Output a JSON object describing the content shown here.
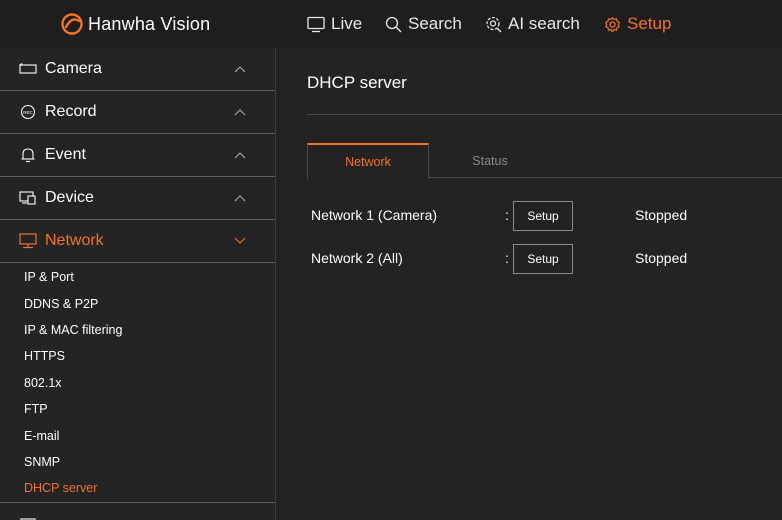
{
  "brand": {
    "name": "Hanwha Vision",
    "accent": "#f37321"
  },
  "topnav": [
    {
      "label": "Live",
      "icon": "monitor-icon",
      "active": false
    },
    {
      "label": "Search",
      "icon": "search-icon",
      "active": false
    },
    {
      "label": "AI search",
      "icon": "ai-search-icon",
      "active": false
    },
    {
      "label": "Setup",
      "icon": "gear-icon",
      "active": true
    }
  ],
  "sidebar": {
    "menus": [
      {
        "label": "Camera",
        "icon": "camera-icon",
        "expanded": false
      },
      {
        "label": "Record",
        "icon": "record-icon",
        "expanded": false
      },
      {
        "label": "Event",
        "icon": "bell-icon",
        "expanded": false
      },
      {
        "label": "Device",
        "icon": "device-icon",
        "expanded": false
      },
      {
        "label": "Network",
        "icon": "network-monitor-icon",
        "expanded": true,
        "active": true
      }
    ],
    "network_items": [
      "IP & Port",
      "DDNS & P2P",
      "IP & MAC filtering",
      "HTTPS",
      "802.1x",
      "FTP",
      "E-mail",
      "SNMP",
      "DHCP server"
    ],
    "active_item": "DHCP server"
  },
  "main": {
    "title": "DHCP server",
    "tabs": [
      {
        "label": "Network",
        "active": true
      },
      {
        "label": "Status",
        "active": false
      }
    ],
    "rows": [
      {
        "label": "Network 1 (Camera)",
        "separator": ":",
        "button": "Setup",
        "status": "Stopped"
      },
      {
        "label": "Network 2 (All)",
        "separator": ":",
        "button": "Setup",
        "status": "Stopped"
      }
    ]
  }
}
